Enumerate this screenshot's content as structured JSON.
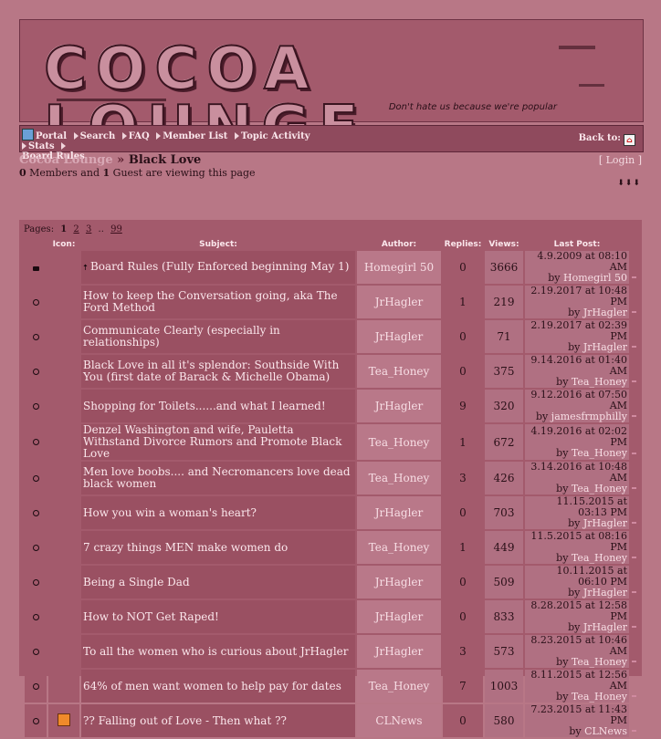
{
  "banner": {
    "logo_text": "COCOA LOUNGE",
    "tagline": "Don't hate us because we're popular"
  },
  "nav": {
    "links": [
      "Portal",
      "Search",
      "FAQ",
      "Member List",
      "Topic Activity",
      "Stats",
      "Board Rules"
    ],
    "back_to": "Back to:"
  },
  "breadcrumb": {
    "root": "Cocoa Lounge",
    "separator": "»",
    "current": "Black Love"
  },
  "login": "[ Login ]",
  "viewing": {
    "members": "0",
    "members_text": "Members and",
    "guests": "1",
    "guests_text": "Guest are viewing this page"
  },
  "arrows": "⬇⬇⬇",
  "pagination": {
    "label": "Pages:",
    "current": "1",
    "pages": [
      "2",
      "3"
    ],
    "ellipsis": "..",
    "last": "99"
  },
  "columns": {
    "icon": "Icon:",
    "subject": "Subject:",
    "author": "Author:",
    "replies": "Replies:",
    "views": "Views:",
    "last_post": "Last Post:"
  },
  "topics": [
    {
      "status": "locked",
      "icon": "",
      "pinned": true,
      "subject": "Board Rules (Fully Enforced beginning May 1)",
      "author": "Homegirl 50",
      "replies": "0",
      "views": "3666",
      "last_date": "4.9.2009 at 08:10 AM",
      "last_by": "Homegirl 50"
    },
    {
      "status": "normal",
      "icon": "",
      "pinned": false,
      "subject": "How to keep the Conversation going, aka The Ford Method",
      "author": "JrHagler",
      "replies": "1",
      "views": "219",
      "last_date": "2.19.2017 at 10:48 PM",
      "last_by": "JrHagler"
    },
    {
      "status": "normal",
      "icon": "",
      "pinned": false,
      "subject": "Communicate Clearly (especially in relationships)",
      "author": "JrHagler",
      "replies": "0",
      "views": "71",
      "last_date": "2.19.2017 at 02:39 PM",
      "last_by": "JrHagler"
    },
    {
      "status": "normal",
      "icon": "",
      "pinned": false,
      "subject": "Black Love in all it's splendor: Southside With You (first date of Barack & Michelle Obama)",
      "author": "Tea_Honey",
      "replies": "0",
      "views": "375",
      "last_date": "9.14.2016 at 01:40 AM",
      "last_by": "Tea_Honey"
    },
    {
      "status": "normal",
      "icon": "",
      "pinned": false,
      "subject": "Shopping for Toilets......and what I learned!",
      "author": "JrHagler",
      "replies": "9",
      "views": "320",
      "last_date": "9.12.2016 at 07:50 AM",
      "last_by": "jamesfrmphilly"
    },
    {
      "status": "normal",
      "icon": "",
      "pinned": false,
      "subject": "Denzel Washington and wife, Pauletta Withstand Divorce Rumors and Promote Black Love",
      "author": "Tea_Honey",
      "replies": "1",
      "views": "672",
      "last_date": "4.19.2016 at 02:02 PM",
      "last_by": "Tea_Honey"
    },
    {
      "status": "normal",
      "icon": "",
      "pinned": false,
      "subject": "Men love boobs.... and Necromancers love dead black women",
      "author": "Tea_Honey",
      "replies": "3",
      "views": "426",
      "last_date": "3.14.2016 at 10:48 AM",
      "last_by": "Tea_Honey"
    },
    {
      "status": "normal",
      "icon": "",
      "pinned": false,
      "subject": "How you win a woman's heart?",
      "author": "JrHagler",
      "replies": "0",
      "views": "703",
      "last_date": "11.15.2015 at 03:13 PM",
      "last_by": "JrHagler"
    },
    {
      "status": "normal",
      "icon": "",
      "pinned": false,
      "subject": "7 crazy things MEN make women do",
      "author": "Tea_Honey",
      "replies": "1",
      "views": "449",
      "last_date": "11.5.2015 at 08:16 PM",
      "last_by": "Tea_Honey"
    },
    {
      "status": "normal",
      "icon": "",
      "pinned": false,
      "subject": "Being a Single Dad",
      "author": "JrHagler",
      "replies": "0",
      "views": "509",
      "last_date": "10.11.2015 at 06:10 PM",
      "last_by": "JrHagler"
    },
    {
      "status": "normal",
      "icon": "",
      "pinned": false,
      "subject": "How to NOT Get Raped!",
      "author": "JrHagler",
      "replies": "0",
      "views": "833",
      "last_date": "8.28.2015 at 12:58 PM",
      "last_by": "JrHagler"
    },
    {
      "status": "normal",
      "icon": "",
      "pinned": false,
      "subject": "To all the women who is curious about JrHagler",
      "author": "JrHagler",
      "replies": "3",
      "views": "573",
      "last_date": "8.23.2015 at 10:46 AM",
      "last_by": "Tea_Honey"
    },
    {
      "status": "normal",
      "icon": "",
      "pinned": false,
      "subject": "64% of men want women to help pay for dates",
      "author": "Tea_Honey",
      "replies": "7",
      "views": "1003",
      "last_date": "8.11.2015 at 12:56 AM",
      "last_by": "Tea_Honey"
    },
    {
      "status": "normal",
      "icon": "rss",
      "pinned": false,
      "subject": "?? Falling out of Love - Then what ??",
      "author": "CLNews",
      "replies": "0",
      "views": "580",
      "last_date": "7.23.2015 at 11:43 PM",
      "last_by": "CLNews"
    }
  ],
  "colors": {
    "page_bg": "#b87786",
    "panel": "#a35a6c",
    "nav": "#8f4a5d",
    "author_cell": "#b97889"
  }
}
